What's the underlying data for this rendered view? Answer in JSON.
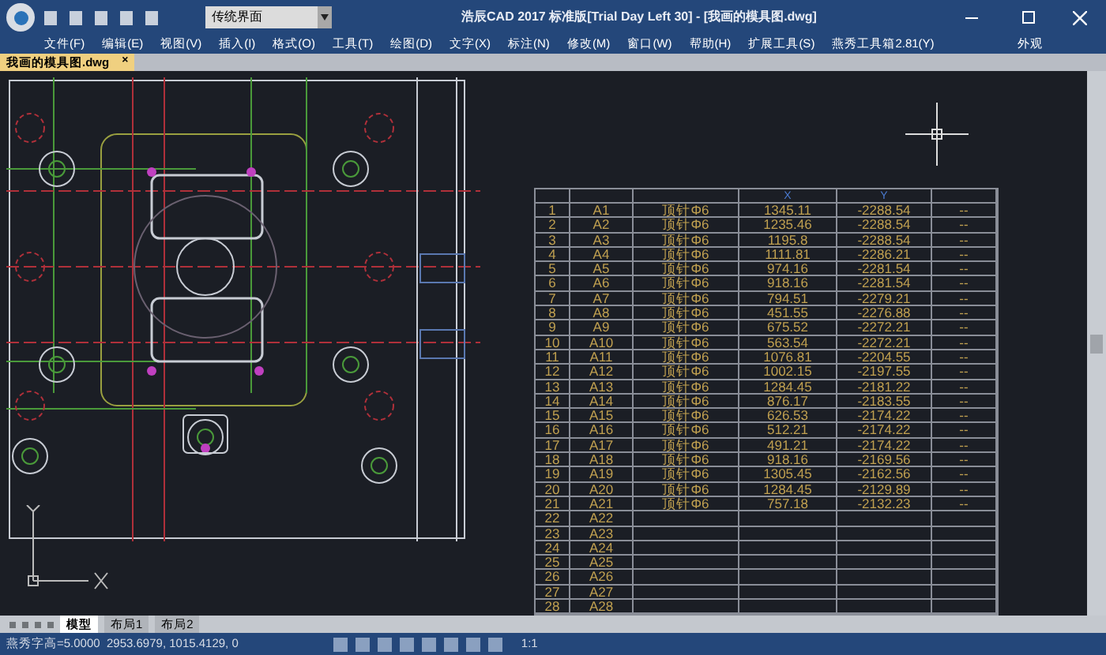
{
  "window": {
    "title": "浩辰CAD 2017 标准版[Trial Day Left 30] - [我画的模具图.dwg]"
  },
  "toolbar": {
    "workspace_dropdown": "传统界面"
  },
  "menu": [
    "文件(F)",
    "编辑(E)",
    "视图(V)",
    "插入(I)",
    "格式(O)",
    "工具(T)",
    "绘图(D)",
    "文字(X)",
    "标注(N)",
    "修改(M)",
    "窗口(W)",
    "帮助(H)",
    "扩展工具(S)",
    "燕秀工具箱2.81(Y)"
  ],
  "menu_right": "外观",
  "document_tabs": [
    {
      "label": "我画的模具图.dwg",
      "close": "×",
      "selected": true
    }
  ],
  "table": {
    "columns": [
      "",
      "",
      "",
      "X",
      "Y",
      ""
    ],
    "rows": [
      [
        "1",
        "A1",
        "顶针Φ6",
        "1345.11",
        "-2288.54",
        "--"
      ],
      [
        "2",
        "A2",
        "顶针Φ6",
        "1235.46",
        "-2288.54",
        "--"
      ],
      [
        "3",
        "A3",
        "顶针Φ6",
        "1195.8",
        "-2288.54",
        "--"
      ],
      [
        "4",
        "A4",
        "顶针Φ6",
        "1111.81",
        "-2286.21",
        "--"
      ],
      [
        "5",
        "A5",
        "顶针Φ6",
        "974.16",
        "-2281.54",
        "--"
      ],
      [
        "6",
        "A6",
        "顶针Φ6",
        "918.16",
        "-2281.54",
        "--"
      ],
      [
        "7",
        "A7",
        "顶针Φ6",
        "794.51",
        "-2279.21",
        "--"
      ],
      [
        "8",
        "A8",
        "顶针Φ6",
        "451.55",
        "-2276.88",
        "--"
      ],
      [
        "9",
        "A9",
        "顶针Φ6",
        "675.52",
        "-2272.21",
        "--"
      ],
      [
        "10",
        "A10",
        "顶针Φ6",
        "563.54",
        "-2272.21",
        "--"
      ],
      [
        "11",
        "A11",
        "顶针Φ6",
        "1076.81",
        "-2204.55",
        "--"
      ],
      [
        "12",
        "A12",
        "顶针Φ6",
        "1002.15",
        "-2197.55",
        "--"
      ],
      [
        "13",
        "A13",
        "顶针Φ6",
        "1284.45",
        "-2181.22",
        "--"
      ],
      [
        "14",
        "A14",
        "顶针Φ6",
        "876.17",
        "-2183.55",
        "--"
      ],
      [
        "15",
        "A15",
        "顶针Φ6",
        "626.53",
        "-2174.22",
        "--"
      ],
      [
        "16",
        "A16",
        "顶针Φ6",
        "512.21",
        "-2174.22",
        "--"
      ],
      [
        "17",
        "A17",
        "顶针Φ6",
        "491.21",
        "-2174.22",
        "--"
      ],
      [
        "18",
        "A18",
        "顶针Φ6",
        "918.16",
        "-2169.56",
        "--"
      ],
      [
        "19",
        "A19",
        "顶针Φ6",
        "1305.45",
        "-2162.56",
        "--"
      ],
      [
        "20",
        "A20",
        "顶针Φ6",
        "1284.45",
        "-2129.89",
        "--"
      ],
      [
        "21",
        "A21",
        "顶针Φ6",
        "757.18",
        "-2132.23",
        "--"
      ],
      [
        "22",
        "A22",
        "",
        "",
        "",
        ""
      ],
      [
        "23",
        "A23",
        "",
        "",
        "",
        ""
      ],
      [
        "24",
        "A24",
        "",
        "",
        "",
        ""
      ],
      [
        "25",
        "A25",
        "",
        "",
        "",
        ""
      ],
      [
        "26",
        "A26",
        "",
        "",
        "",
        ""
      ],
      [
        "27",
        "A27",
        "",
        "",
        "",
        ""
      ],
      [
        "28",
        "A28",
        "",
        "",
        "",
        ""
      ]
    ]
  },
  "layout_tabs": [
    {
      "label": "模型",
      "selected": true
    },
    {
      "label": "布局1",
      "selected": false
    },
    {
      "label": "布局2",
      "selected": false
    }
  ],
  "status_bar": {
    "coordinates": "燕秀字高=5.0000  2953.6979, 1015.4129, 0",
    "scale": "1:1"
  }
}
